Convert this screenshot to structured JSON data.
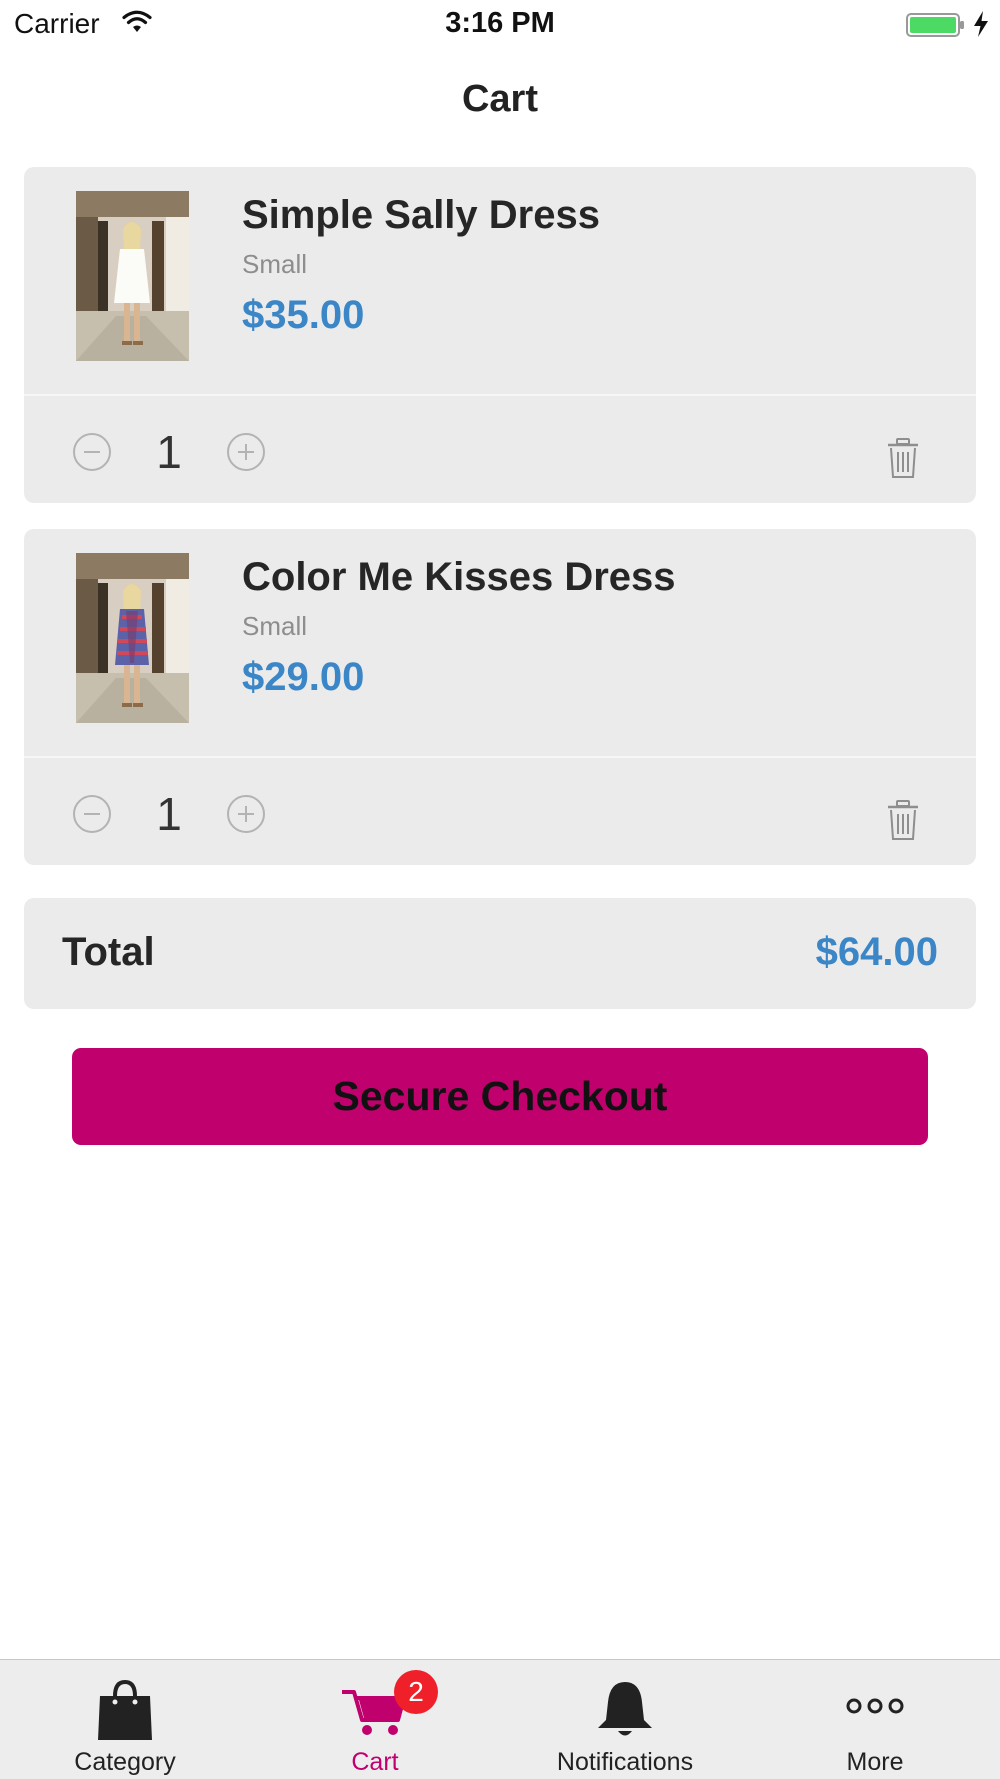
{
  "status_bar": {
    "carrier": "Carrier",
    "time": "3:16 PM",
    "wifi_icon": "wifi-icon",
    "battery_icon": "battery-charging-icon",
    "battery_color": "#4cd964"
  },
  "nav": {
    "title": "Cart"
  },
  "cart_items": [
    {
      "name": "Simple Sally Dress",
      "size": "Small",
      "price": "$35.00",
      "quantity": "1",
      "thumb_icon": "product-photo-white-dress"
    },
    {
      "name": "Color Me Kisses Dress",
      "size": "Small",
      "price": "$29.00",
      "quantity": "1",
      "thumb_icon": "product-photo-patterned-dress"
    }
  ],
  "total": {
    "label": "Total",
    "value": "$64.00"
  },
  "checkout": {
    "label": "Secure Checkout"
  },
  "tab_bar": {
    "tabs": [
      {
        "label": "Category",
        "icon": "shopping-bag-icon"
      },
      {
        "label": "Cart",
        "icon": "cart-icon",
        "badge": "2",
        "active": true
      },
      {
        "label": "Notifications",
        "icon": "bell-icon"
      },
      {
        "label": "More",
        "icon": "more-dots-icon"
      }
    ]
  },
  "colors": {
    "accent": "#c0006d",
    "price": "#3a86c6",
    "card_bg": "#ebebec",
    "badge": "#f0202a"
  }
}
